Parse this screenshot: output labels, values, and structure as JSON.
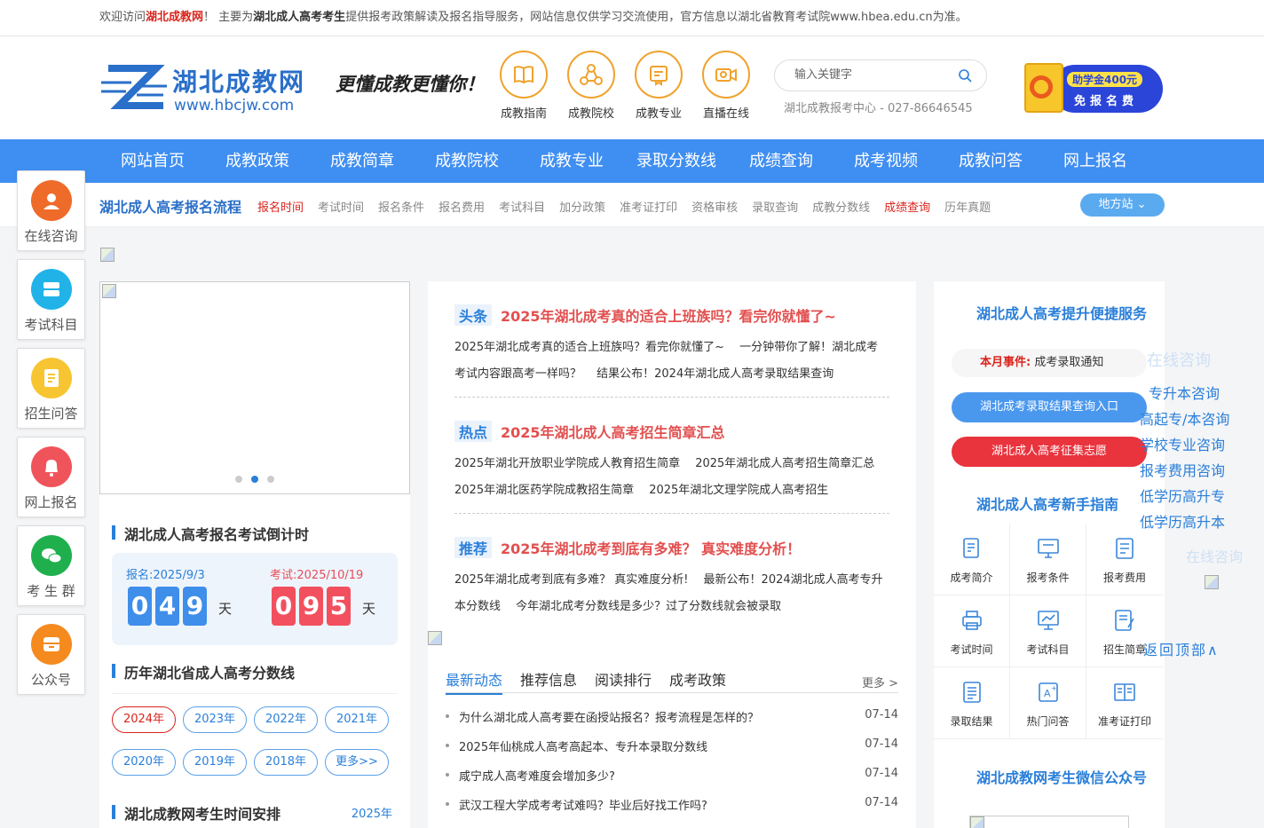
{
  "notice": {
    "prefix": "欢迎访问",
    "site": "湖北成教网",
    "mid1": "！ 主要为",
    "bold": "湖北成人高考考生",
    "rest": "提供报考政策解读及报名指导服务，网站信息仅供学习交流使用，官方信息以湖北省教育考试院www.hbea.edu.cn为准。"
  },
  "header": {
    "logo_name": "湖北成教网",
    "logo_url": "www.hbcjw.com",
    "slogan": "更懂成教更懂你！",
    "quick_nav": [
      {
        "label": "成教指南",
        "icon": "book-icon"
      },
      {
        "label": "成教院校",
        "icon": "network-icon"
      },
      {
        "label": "成教专业",
        "icon": "certificate-icon"
      },
      {
        "label": "直播在线",
        "icon": "video-camera-icon"
      }
    ],
    "search_placeholder": "输入关键字",
    "phone": "湖北成教报考中心 - 027-86646545",
    "promo_line1": "助学金400元",
    "promo_line2": "免报名费",
    "colors": {
      "accent": "#3f8ef1",
      "orange": "#f0a22c",
      "red": "#d9251d"
    }
  },
  "nav": [
    "网站首页",
    "成教政策",
    "成教简章",
    "成教院校",
    "成教专业",
    "录取分数线",
    "成绩查询",
    "成考视频",
    "成教问答",
    "网上报名"
  ],
  "process": {
    "title": "湖北成人高考报名流程",
    "links": [
      {
        "label": "报名时间",
        "red": true
      },
      {
        "label": "考试时间",
        "red": false
      },
      {
        "label": "报名条件",
        "red": false
      },
      {
        "label": "报名费用",
        "red": false
      },
      {
        "label": "考试科目",
        "red": false
      },
      {
        "label": "加分政策",
        "red": false
      },
      {
        "label": "准考证打印",
        "red": false
      },
      {
        "label": "资格审核",
        "red": false
      },
      {
        "label": "录取查询",
        "red": false
      },
      {
        "label": "成教分数线",
        "red": false
      },
      {
        "label": "成绩查询",
        "red": true
      },
      {
        "label": "历年真题",
        "red": false
      }
    ],
    "site_button": "地方站"
  },
  "float_sidebar": [
    {
      "label": "在线咨询",
      "icon": "customer-service-icon",
      "color": "#ee6b2a"
    },
    {
      "label": "考试科目",
      "icon": "server-icon",
      "color": "#21b3e8"
    },
    {
      "label": "招生问答",
      "icon": "document-icon",
      "color": "#f7c531"
    },
    {
      "label": "网上报名",
      "icon": "bell-icon",
      "color": "#f0545b"
    },
    {
      "label": "考 生 群",
      "icon": "wechat-icon",
      "color": "#1fb04d"
    },
    {
      "label": "公众号",
      "icon": "archive-icon",
      "color": "#f58a1f"
    }
  ],
  "left": {
    "countdown_title": "湖北成人高考报名考试倒计时",
    "signup_label": "报名:2025/9/3",
    "signup_days": [
      "0",
      "4",
      "9"
    ],
    "exam_label": "考试:2025/10/19",
    "exam_days": [
      "0",
      "9",
      "5"
    ],
    "day_unit": "天",
    "scores_title": "历年湖北省成人高考分数线",
    "years": [
      {
        "label": "2024年",
        "on": true
      },
      {
        "label": "2023年",
        "on": false
      },
      {
        "label": "2022年",
        "on": false
      },
      {
        "label": "2021年",
        "on": false
      },
      {
        "label": "2020年",
        "on": false
      },
      {
        "label": "2019年",
        "on": false
      },
      {
        "label": "2018年",
        "on": false
      },
      {
        "label": "更多>>",
        "on": false
      }
    ],
    "schedule_title": "湖北成教网考生时间安排",
    "schedule_year": "2025年"
  },
  "middle": {
    "news": [
      {
        "tag": "头条",
        "title": "2025年湖北成考真的适合上班族吗？看完你就懂了~",
        "text": "2025年湖北成考真的适合上班族吗？看完你就懂了~　 一分钟带你了解！湖北成考考试内容跟高考一样吗？　 结果公布！2024年湖北成人高考录取结果查询"
      },
      {
        "tag": "热点",
        "title": "2025年湖北成人高考招生简章汇总",
        "text": "2025年湖北开放职业学院成人教育招生简章　 2025年湖北成人高考招生简章汇总　 2025年湖北医药学院成教招生简章　 2025年湖北文理学院成人高考招生"
      },
      {
        "tag": "推荐",
        "title": "2025年湖北成考到底有多难？ 真实难度分析！",
        "text": "2025年湖北成考到底有多难？ 真实难度分析!　 最新公布！2024湖北成人高考专升本分数线　 今年湖北成考分数线是多少？过了分数线就会被录取"
      }
    ],
    "tabs": [
      "最新动态",
      "推荐信息",
      "阅读排行",
      "成考政策"
    ],
    "more": "更多 >",
    "list": [
      {
        "title": "为什么湖北成人高考要在函授站报名？报考流程是怎样的？",
        "date": "07-14"
      },
      {
        "title": "2025年仙桃成人高考高起本、专升本录取分数线",
        "date": "07-14"
      },
      {
        "title": "咸宁成人高考难度会增加多少?",
        "date": "07-14"
      },
      {
        "title": "武汉工程大学成考考试难吗？毕业后好找工作吗?",
        "date": "07-14"
      }
    ]
  },
  "right": {
    "service_title": "湖北成人高考提升便捷服务",
    "event_label": "本月事件:",
    "event_text": "成考录取通知",
    "btn_blue": "湖北成考录取结果查询入口",
    "btn_red": "湖北成人高考征集志愿",
    "guide_title": "湖北成人高考新手指南",
    "grid": [
      {
        "label": "成考简介",
        "icon": "edit-doc-icon"
      },
      {
        "label": "报考条件",
        "icon": "monitor-icon"
      },
      {
        "label": "报考费用",
        "icon": "form-icon"
      },
      {
        "label": "考试时间",
        "icon": "printer-icon"
      },
      {
        "label": "考试科目",
        "icon": "computer-icon"
      },
      {
        "label": "招生简章",
        "icon": "pen-doc-icon"
      },
      {
        "label": "录取结果",
        "icon": "list-doc-icon"
      },
      {
        "label": "热门问答",
        "icon": "qa-icon"
      },
      {
        "label": "准考证打印",
        "icon": "id-card-icon"
      }
    ],
    "wechat_title": "湖北成教网考生微信公众号"
  },
  "consult": {
    "ghost": "在线咨询",
    "items": [
      "专升本咨询",
      "高起专/本咨询",
      "学校专业咨询",
      "报考费用咨询",
      "低学历高升专",
      "低学历高升本"
    ],
    "ghost2": "在线咨询",
    "back_to_top": "返回顶部∧"
  }
}
